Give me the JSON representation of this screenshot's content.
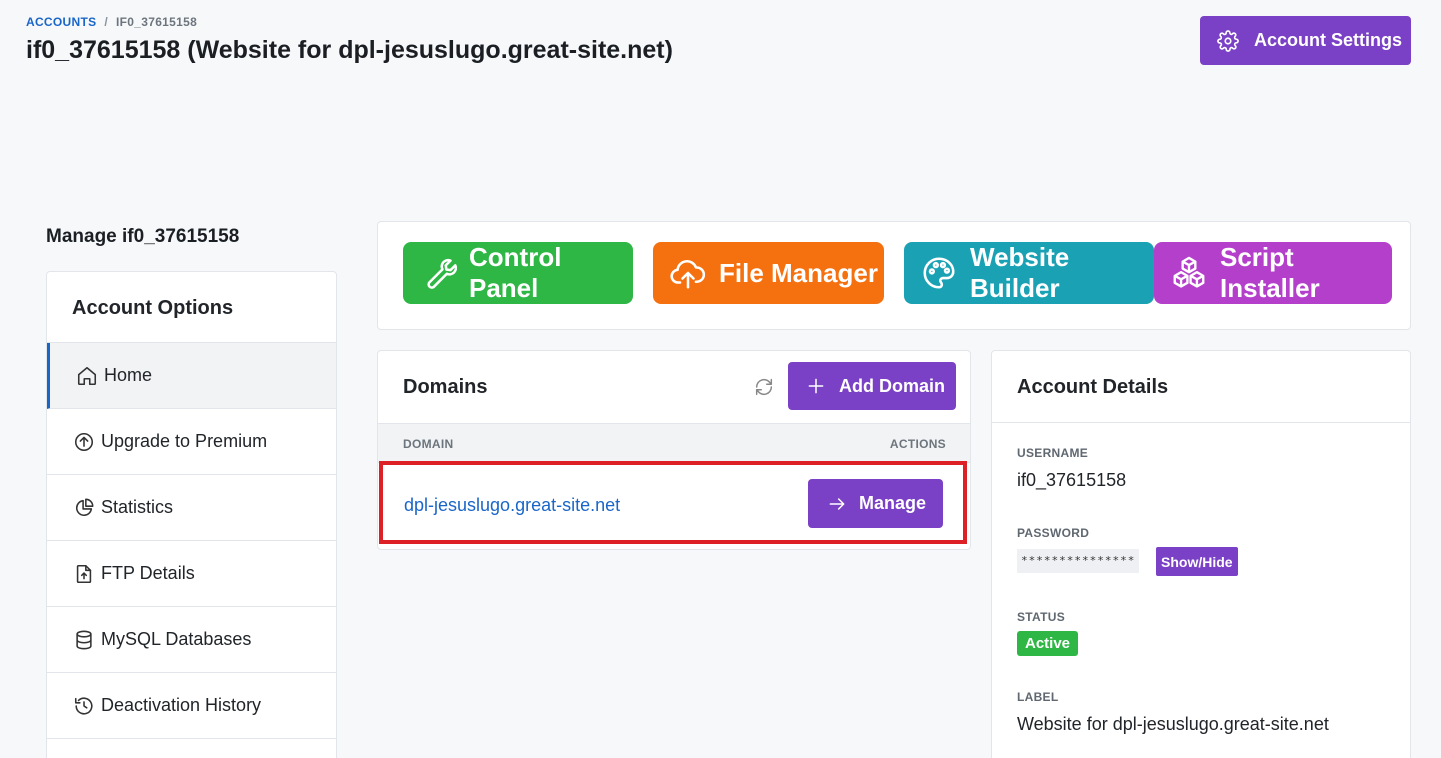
{
  "breadcrumb": {
    "root": "ACCOUNTS",
    "separator": "/",
    "current": "IF0_37615158"
  },
  "page_title": "if0_37615158 (Website for dpl-jesuslugo.great-site.net)",
  "header": {
    "settings_label": "Account Settings",
    "settings_icon": "gear-icon"
  },
  "manage_title": "Manage if0_37615158",
  "sidebar": {
    "title": "Account Options",
    "items": [
      {
        "label": "Home",
        "icon": "home-icon"
      },
      {
        "label": "Upgrade to Premium",
        "icon": "arrow-up-circle-icon"
      },
      {
        "label": "Statistics",
        "icon": "pie-chart-icon"
      },
      {
        "label": "FTP Details",
        "icon": "file-upload-icon"
      },
      {
        "label": "MySQL Databases",
        "icon": "database-icon"
      },
      {
        "label": "Deactivation History",
        "icon": "history-icon"
      }
    ]
  },
  "tools": [
    {
      "label": "Control Panel",
      "icon": "wrench-icon",
      "color": "#2eb745"
    },
    {
      "label": "File Manager",
      "icon": "cloud-upload-icon",
      "color": "#f5700f"
    },
    {
      "label": "Website Builder",
      "icon": "palette-icon",
      "color": "#1aa2b4"
    },
    {
      "label": "Script Installer",
      "icon": "cubes-icon",
      "color": "#b43fcb"
    }
  ],
  "domains": {
    "title": "Domains",
    "add_label": "Add Domain",
    "columns": [
      "DOMAIN",
      "ACTIONS"
    ],
    "rows": [
      {
        "domain": "dpl-jesuslugo.great-site.net",
        "action": "Manage"
      }
    ]
  },
  "details": {
    "title": "Account Details",
    "username_label": "USERNAME",
    "username": "if0_37615158",
    "password_label": "PASSWORD",
    "password_mask": "***************",
    "show_hide_label": "Show/Hide",
    "status_label": "STATUS",
    "status": "Active",
    "label_label": "LABEL",
    "label": "Website for dpl-jesuslugo.great-site.net"
  },
  "colors": {
    "accent": "#7a40c6",
    "link": "#1a66c8",
    "highlight": "#dd1f26",
    "success": "#2eb745"
  }
}
